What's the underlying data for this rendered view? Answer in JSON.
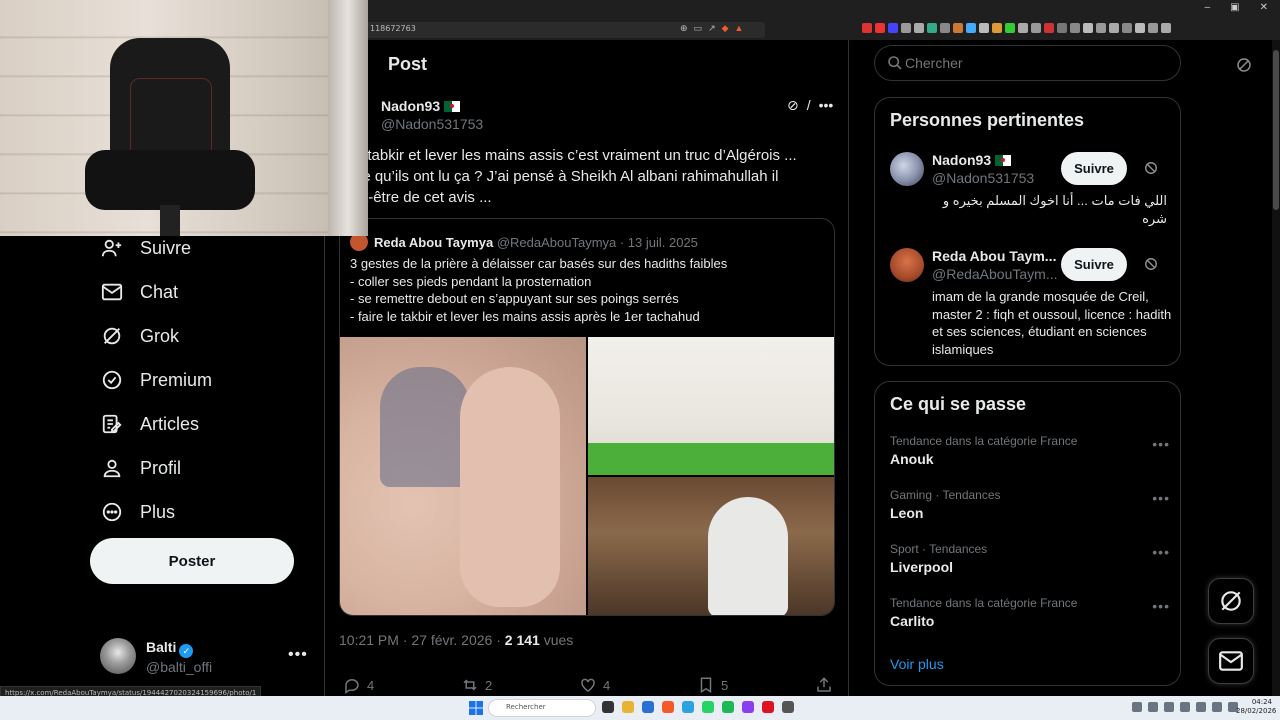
{
  "browser": {
    "url": "118672763"
  },
  "nav": {
    "items": [
      {
        "label": "Suivre",
        "icon": "person-add-icon"
      },
      {
        "label": "Chat",
        "icon": "mail-icon"
      },
      {
        "label": "Grok",
        "icon": "grok-icon"
      },
      {
        "label": "Premium",
        "icon": "verified-badge-icon"
      },
      {
        "label": "Articles",
        "icon": "article-edit-icon"
      },
      {
        "label": "Profil",
        "icon": "profile-icon"
      },
      {
        "label": "Plus",
        "icon": "more-circle-icon"
      }
    ],
    "post_button": "Poster",
    "account": {
      "name": "Balti",
      "handle": "@balti_offi"
    }
  },
  "post": {
    "header": "Post",
    "author_name": "Nadon93",
    "author_handle": "@Nadon531753",
    "text_lines": [
      "e le tabkir et lever les mains assis c’est vraiment un truc d’Algérois ...",
      "st ce qu’ils ont lu ça ? J’ai pensé à Sheikh Al albani rahimahullah il",
      "peut-être de cet avis ..."
    ],
    "quote": {
      "name": "Reda Abou Taymya",
      "meta": "@RedaAbouTaymya · 13 juil. 2025",
      "lines": [
        "3 gestes de la prière à délaisser car basés sur des hadiths faibles",
        "- coller ses pieds pendant la prosternation",
        "- se remettre debout en s’appuyant sur ses poings serrés",
        "- faire le takbir et lever les mains assis après le 1er tachahud"
      ]
    },
    "meta_time": "10:21 PM · 27 févr. 2026 · ",
    "meta_views": "2 141",
    "meta_views_label": " vues",
    "stats": {
      "replies": "4",
      "reposts": "2",
      "likes": "4",
      "bookmarks": "5"
    }
  },
  "right": {
    "search_placeholder": "Chercher",
    "people_title": "Personnes pertinentes",
    "people": [
      {
        "name": "Nadon93",
        "handle": "@Nadon531753",
        "follow": "Suivre",
        "bio": "اللي فات مات ... أنا اخوك المسلم بخيره و شره"
      },
      {
        "name": "Reda Abou Taym...",
        "handle": "@RedaAbouTaym...",
        "follow": "Suivre",
        "bio": "imam de la grande mosquée de Creil, master 2 : fiqh et oussoul, licence : hadith et ses sciences, étudiant en sciences islamiques"
      }
    ],
    "trends_title": "Ce qui se passe",
    "trends": [
      {
        "meta": "Tendance dans la catégorie France",
        "name": "Anouk"
      },
      {
        "meta": "Gaming · Tendances",
        "name": "Leon"
      },
      {
        "meta": "Sport · Tendances",
        "name": "Liverpool"
      },
      {
        "meta": "Tendance dans la catégorie France",
        "name": "Carlito"
      }
    ],
    "see_more": "Voir plus"
  },
  "status_url": "https://x.com/RedaAbouTaymya/status/1944427020324159696/photo/1",
  "taskbar": {
    "search_label": "Rechercher",
    "time": "04:24",
    "date": "28/02/2026"
  },
  "colors": {
    "accent": "#1d9bf0",
    "background": "#000000",
    "muted": "#71767b",
    "border": "#2f3336"
  }
}
